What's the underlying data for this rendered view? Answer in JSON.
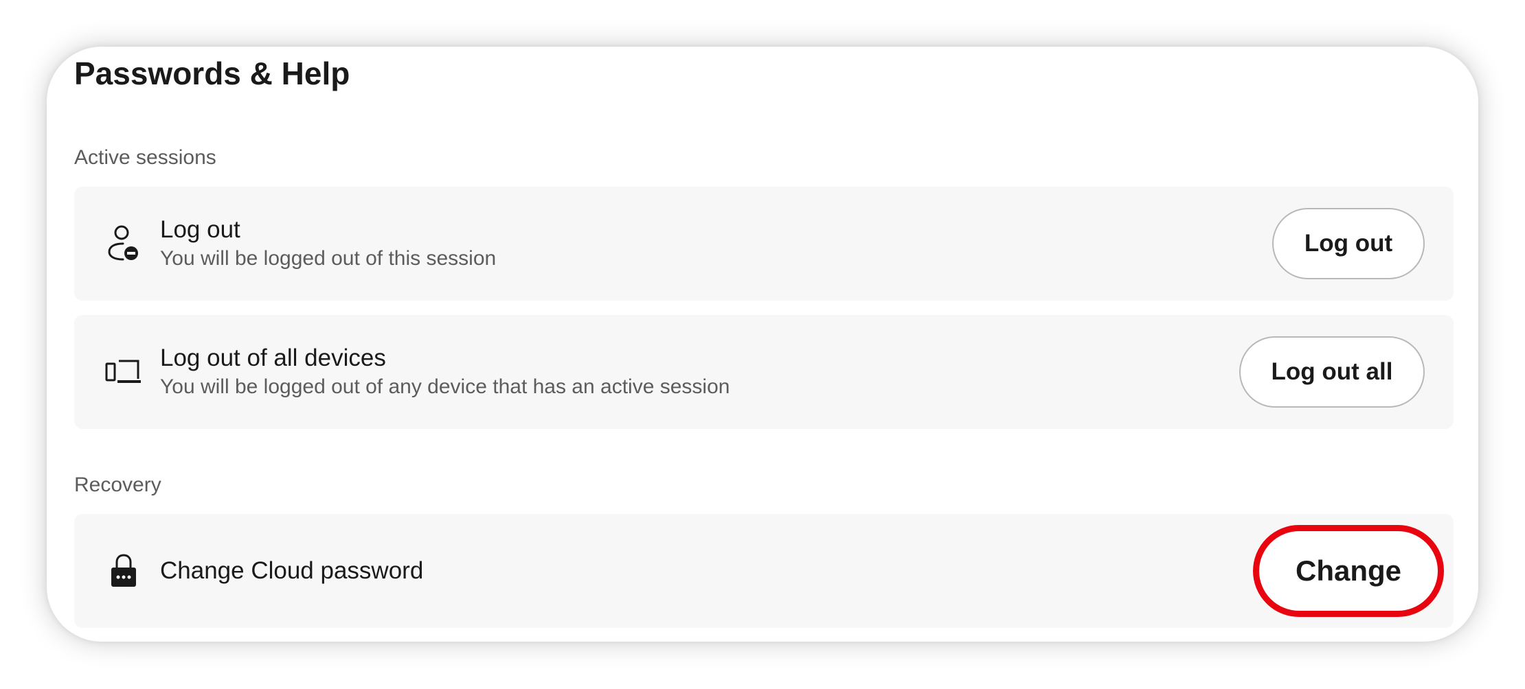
{
  "page": {
    "title": "Passwords & Help"
  },
  "sections": {
    "active_sessions": {
      "label": "Active sessions",
      "rows": [
        {
          "icon": "user-logout-icon",
          "title": "Log out",
          "subtitle": "You will be logged out of this session",
          "button_label": "Log out"
        },
        {
          "icon": "devices-icon",
          "title": "Log out of all devices",
          "subtitle": "You will be logged out of any device that has an active session",
          "button_label": "Log out all"
        }
      ]
    },
    "recovery": {
      "label": "Recovery",
      "rows": [
        {
          "icon": "lock-icon",
          "title": "Change Cloud password",
          "button_label": "Change"
        }
      ]
    }
  },
  "colors": {
    "highlight": "#e8050f",
    "row_background": "#f6f7f6",
    "secondary_text": "#5c5c5c"
  }
}
